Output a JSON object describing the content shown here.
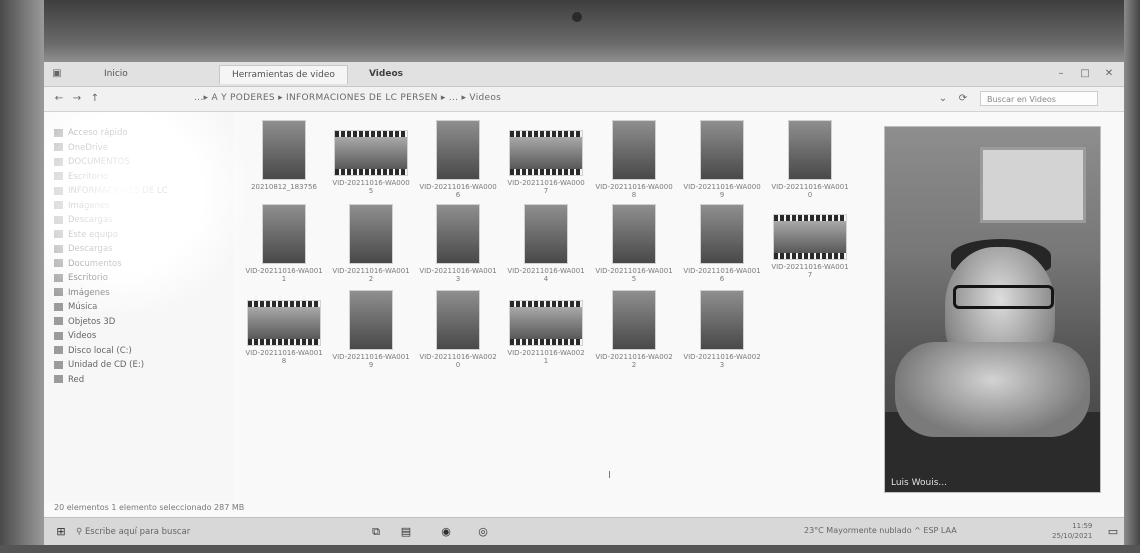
{
  "window": {
    "tab_left": "Inicio",
    "tab_active": "Herramientas de video",
    "tab_title": "Videos"
  },
  "address": {
    "path": "...▸ A Y PODERES ▸ INFORMACIONES DE LC PERSEN ▸ ... ▸ Videos",
    "search_placeholder": "Buscar en Videos"
  },
  "sidebar": {
    "items": [
      {
        "label": "Acceso rápido",
        "y": 0
      },
      {
        "label": "OneDrive",
        "y": 0
      },
      {
        "label": "DOCUMENTOS",
        "y": 0
      },
      {
        "label": "Escritorio",
        "y": 0
      },
      {
        "label": "INFORMACIONES DE LC",
        "y": 0
      },
      {
        "label": "Imágenes",
        "y": 0
      },
      {
        "label": "Descargas",
        "y": 0
      },
      {
        "label": "Este equipo",
        "y": 0
      },
      {
        "label": "Descargas",
        "y": 0
      },
      {
        "label": "Documentos",
        "y": 0
      },
      {
        "label": "Escritorio",
        "y": 0
      },
      {
        "label": "Imágenes",
        "y": 0
      },
      {
        "label": "Música",
        "y": 0
      },
      {
        "label": "Objetos 3D",
        "y": 0
      },
      {
        "label": "Videos",
        "y": 0
      },
      {
        "label": "Disco local (C:)",
        "y": 0
      },
      {
        "label": "Unidad de CD (E:)",
        "y": 0
      },
      {
        "label": "Red",
        "y": 0
      }
    ]
  },
  "files": [
    {
      "caption": "20210812_183756",
      "kind": "portrait"
    },
    {
      "caption": "VID-20211016-WA0005",
      "kind": "film"
    },
    {
      "caption": "VID-20211016-WA0006",
      "kind": "portrait"
    },
    {
      "caption": "VID-20211016-WA0007",
      "kind": "film"
    },
    {
      "caption": "VID-20211016-WA0008",
      "kind": "portrait"
    },
    {
      "caption": "VID-20211016-WA0009",
      "kind": "portrait"
    },
    {
      "caption": "VID-20211016-WA0010",
      "kind": "portrait"
    },
    {
      "caption": "VID-20211016-WA0011",
      "kind": "portrait"
    },
    {
      "caption": "VID-20211016-WA0012",
      "kind": "portrait"
    },
    {
      "caption": "VID-20211016-WA0013",
      "kind": "portrait"
    },
    {
      "caption": "VID-20211016-WA0014",
      "kind": "portrait"
    },
    {
      "caption": "VID-20211016-WA0015",
      "kind": "portrait"
    },
    {
      "caption": "VID-20211016-WA0016",
      "kind": "portrait"
    },
    {
      "caption": "VID-20211016-WA0017",
      "kind": "film"
    },
    {
      "caption": "VID-20211016-WA0018",
      "kind": "film"
    },
    {
      "caption": "VID-20211016-WA0019",
      "kind": "portrait"
    },
    {
      "caption": "VID-20211016-WA0020",
      "kind": "portrait"
    },
    {
      "caption": "VID-20211016-WA0021",
      "kind": "film"
    },
    {
      "caption": "VID-20211016-WA0022",
      "kind": "portrait"
    },
    {
      "caption": "VID-20211016-WA0023",
      "kind": "portrait"
    }
  ],
  "video_call": {
    "name_label": "Luis Wouis..."
  },
  "status_bar": {
    "text": "20 elementos    1 elemento seleccionado  287 MB"
  },
  "taskbar": {
    "search_placeholder": "Escribe aquí para buscar",
    "tray_text": "23°C  Mayormente nublado  ^  ESP  LAA",
    "time": "11:59",
    "date": "25/10/2021"
  }
}
